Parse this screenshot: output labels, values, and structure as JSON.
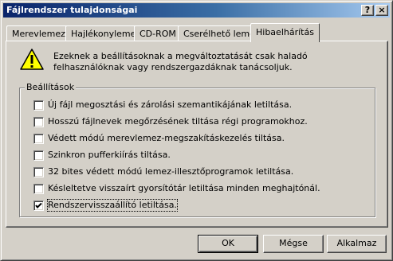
{
  "window": {
    "title": "Fájlrendszer tulajdonságai",
    "help_button": "?",
    "close_button": "×"
  },
  "tabs": [
    {
      "label": "Merevlemez",
      "active": false
    },
    {
      "label": "Hajlékonylemez",
      "active": false
    },
    {
      "label": "CD-ROM",
      "active": false
    },
    {
      "label": "Cserélhető lemez",
      "active": false
    },
    {
      "label": "Hibaelhárítás",
      "active": true
    }
  ],
  "warning": {
    "icon": "warning-triangle-icon",
    "line1": "Ezeknek a beállításoknak a megváltoztatását csak haladó",
    "line2": "felhasználóknak vagy rendszergazdáknak tanácsoljuk."
  },
  "settings": {
    "title": "Beállítások",
    "options": [
      {
        "label": "Új fájl megosztási és zárolási szemantikájának letiltása.",
        "checked": false
      },
      {
        "label": "Hosszú fájlnevek megőrzésének tiltása régi programokhoz.",
        "checked": false
      },
      {
        "label": "Védett módú merevlemez-megszakításkezelés tiltása.",
        "checked": false
      },
      {
        "label": "Szinkron pufferkiírás tiltása.",
        "checked": false
      },
      {
        "label": "32 bites védett módú lemez-illesztőprogramok letiltása.",
        "checked": false
      },
      {
        "label": "Késleltetve visszaírt gyorsítótár letiltása minden meghajtónál.",
        "checked": false
      },
      {
        "label": "Rendszervisszaállító letiltása.",
        "checked": true
      }
    ]
  },
  "buttons": {
    "ok": "OK",
    "cancel": "Mégse",
    "apply": "Alkalmaz"
  },
  "colors": {
    "title_start": "#0a246a",
    "title_end": "#a6caf0",
    "face": "#d4d0c8"
  }
}
